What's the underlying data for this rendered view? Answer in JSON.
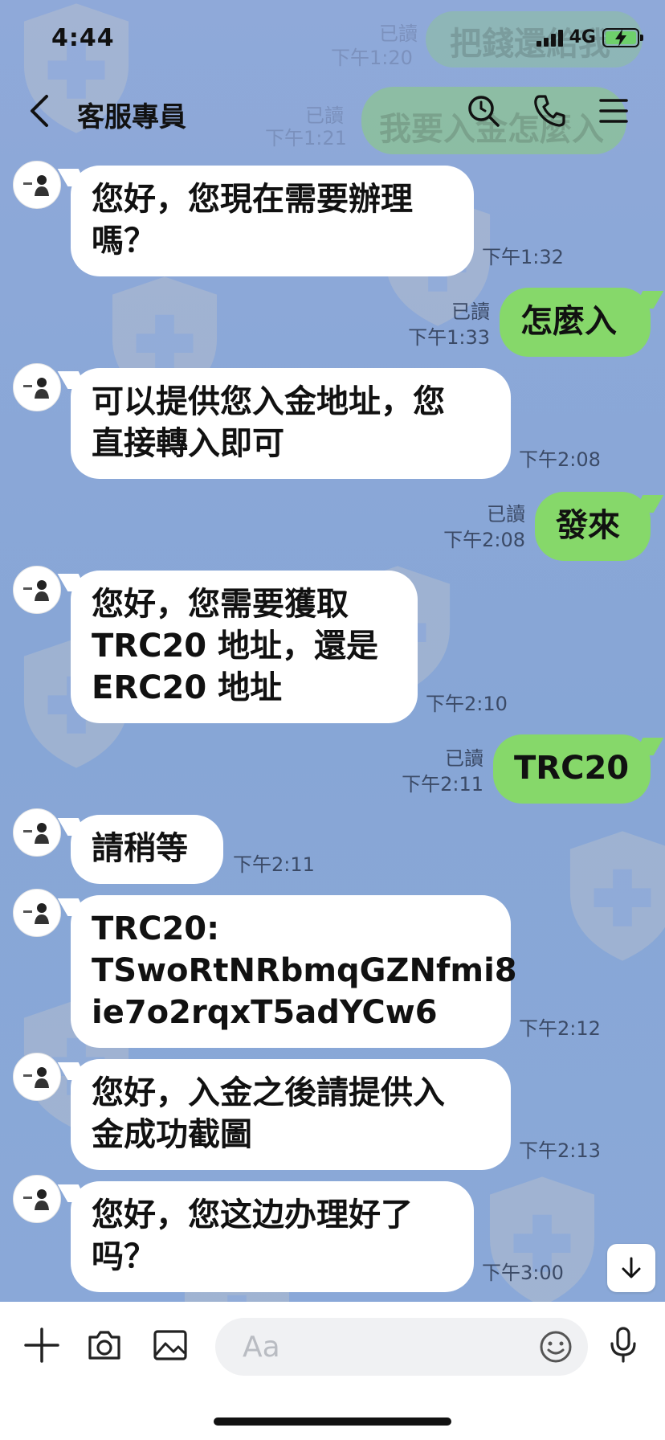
{
  "status_bar": {
    "time": "4:44",
    "network": "4G"
  },
  "header": {
    "title": "客服專員"
  },
  "background_preview": {
    "line1": "把錢還給我",
    "line2": "我要入金怎麼入",
    "meta1": "已讀",
    "meta2": "下午1:20",
    "meta3": "已讀",
    "meta4": "下午1:21"
  },
  "messages": [
    {
      "dir": "in",
      "text_lines": [
        "您好，您現在需要辦理",
        "嗎？"
      ],
      "time": "下午1:32"
    },
    {
      "dir": "out",
      "text_lines": [
        "怎麼入"
      ],
      "read": "已讀",
      "time": "下午1:33"
    },
    {
      "dir": "in",
      "text_lines": [
        "可以提供您入金地址，您",
        "直接轉入即可"
      ],
      "time": "下午2:08"
    },
    {
      "dir": "out",
      "text_lines": [
        "發來"
      ],
      "read": "已讀",
      "time": "下午2:08"
    },
    {
      "dir": "in",
      "text_lines": [
        "您好，您需要獲取",
        "TRC20 地址，還是",
        "ERC20 地址"
      ],
      "time": "下午2:10"
    },
    {
      "dir": "out",
      "text_lines": [
        "TRC20"
      ],
      "read": "已讀",
      "time": "下午2:11"
    },
    {
      "dir": "in",
      "text_lines": [
        "請稍等"
      ],
      "time": "下午2:11"
    },
    {
      "dir": "in",
      "text_lines": [
        "TRC20:",
        "TSwoRtNRbmqGZNfmi8",
        "ie7o2rqxT5adYCw6"
      ],
      "time": "下午2:12"
    },
    {
      "dir": "in",
      "text_lines": [
        "您好，入金之後請提供入",
        "金成功截圖"
      ],
      "time": "下午2:13"
    },
    {
      "dir": "in",
      "text_lines": [
        "您好，您这边办理好了",
        "吗？"
      ],
      "time": "下午3:00"
    }
  ],
  "input": {
    "placeholder": "Aa"
  },
  "icons": {
    "back": "chevron-left-icon",
    "search": "search-icon",
    "call": "phone-icon",
    "menu": "hamburger-menu-icon",
    "add": "plus-icon",
    "camera": "camera-icon",
    "image": "image-icon",
    "emoji": "emoji-icon",
    "mic": "microphone-icon",
    "scroll": "arrow-down-icon"
  },
  "colors": {
    "background": "#8aa8d6",
    "incoming_bubble": "#ffffff",
    "outgoing_bubble": "#86d86a"
  }
}
